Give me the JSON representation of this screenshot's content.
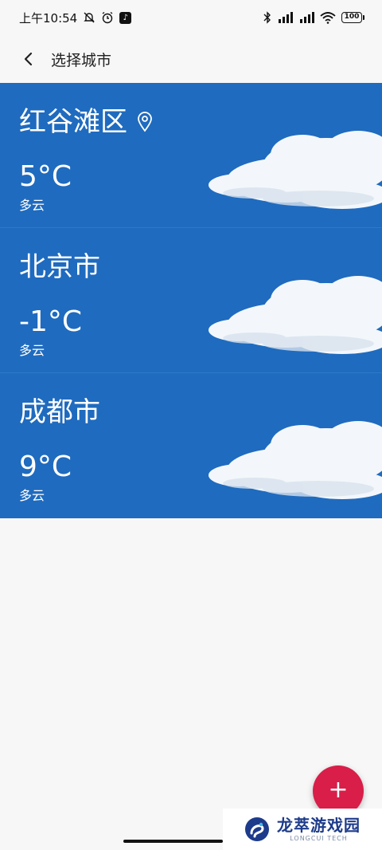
{
  "status_bar": {
    "time": "上午10:54",
    "battery": "100",
    "colors": {
      "text": "#111111"
    }
  },
  "header": {
    "title": "选择城市"
  },
  "cities": [
    {
      "name": "红谷滩区",
      "temperature": "5°C",
      "condition": "多云",
      "is_current_location": true
    },
    {
      "name": "北京市",
      "temperature": "-1°C",
      "condition": "多云"
    },
    {
      "name": "成都市",
      "temperature": "9°C",
      "condition": "多云"
    }
  ],
  "fab": {
    "label": "+"
  },
  "watermark": {
    "title": "龙萃游戏园",
    "subtitle": "LONGCUI TECH"
  },
  "colors": {
    "card_background": "#1f6bbf",
    "fab": "#d81e49",
    "page_background": "#f7f7f7"
  },
  "icons": {
    "back": "chevron-left-icon",
    "location": "location-pin-icon",
    "fab": "plus-icon"
  }
}
